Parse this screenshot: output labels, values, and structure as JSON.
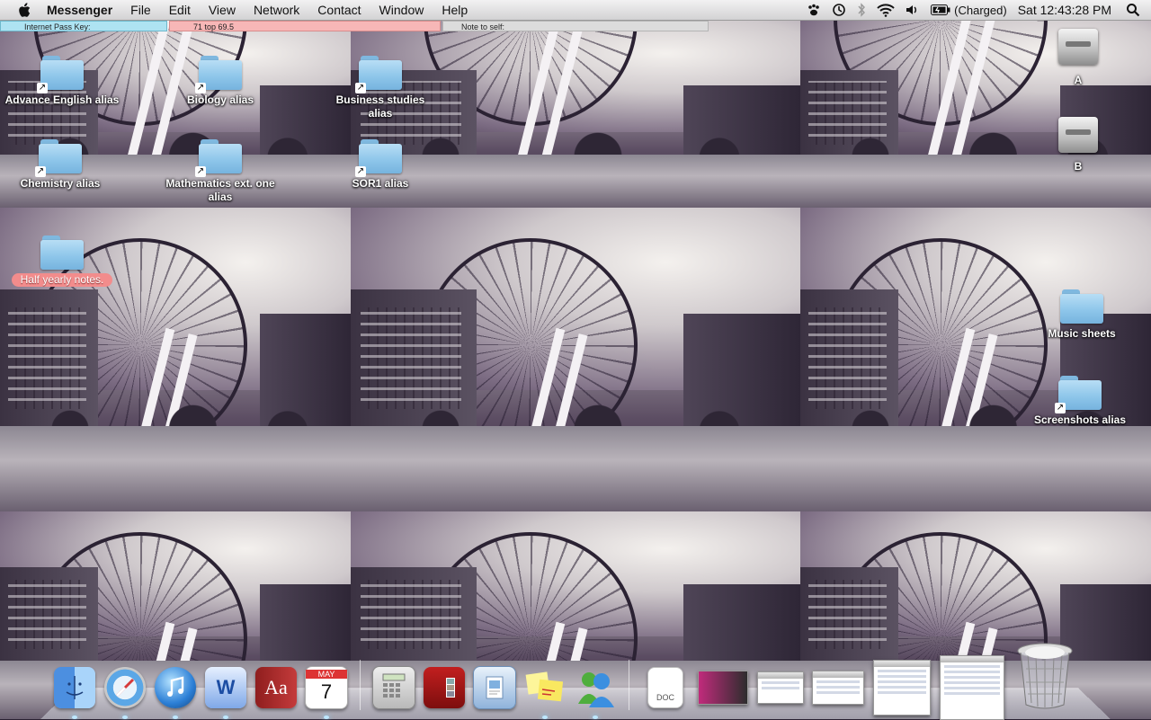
{
  "menubar": {
    "app_name": "Messenger",
    "menus": [
      "File",
      "Edit",
      "View",
      "Network",
      "Contact",
      "Window",
      "Help"
    ],
    "battery_text": "(Charged)",
    "clock": "Sat 12:43:28 PM",
    "status_icons": [
      "paw-icon",
      "time-machine-icon",
      "bluetooth-icon",
      "wifi-icon",
      "volume-icon",
      "battery-icon",
      "spotlight-icon"
    ]
  },
  "stickies": {
    "blue": "Internet Pass Key:",
    "pink": "71 top 69.5",
    "gray": "Note to self:"
  },
  "desktop": {
    "icons": [
      {
        "label": "Advance English alias",
        "kind": "folder-alias"
      },
      {
        "label": "Biology alias",
        "kind": "folder-alias"
      },
      {
        "label": "Business studies alias",
        "kind": "folder-alias"
      },
      {
        "label": "Chemistry alias",
        "kind": "folder-alias"
      },
      {
        "label": "Mathematics ext. one alias",
        "kind": "folder-alias"
      },
      {
        "label": "SOR1 alias",
        "kind": "folder-alias"
      },
      {
        "label": "Half yearly notes.",
        "kind": "folder",
        "label_color": "#f28c8c"
      },
      {
        "label": "A",
        "kind": "drive"
      },
      {
        "label": "B",
        "kind": "drive"
      },
      {
        "label": "Music sheets",
        "kind": "folder"
      },
      {
        "label": "Screenshots alias",
        "kind": "folder-alias"
      }
    ]
  },
  "dock": {
    "apps": [
      "finder-icon",
      "safari-icon",
      "itunes-icon",
      "word-icon",
      "dictionary-icon",
      "ical-icon",
      "calculator-icon",
      "photo-booth-icon",
      "preview-icon",
      "stickies-icon",
      "messenger-icon"
    ],
    "ical_date_month": "MAY",
    "ical_date_day": "7",
    "doc_label": "DOC",
    "dictionary_glyph": "Aa",
    "trash": "trash-icon"
  },
  "colors": {
    "sticky_blue": "#aee3f2",
    "sticky_pink": "#f7b7b7",
    "sticky_gray": "#dcdcdc",
    "folder_blue": "#8ec6ea"
  }
}
